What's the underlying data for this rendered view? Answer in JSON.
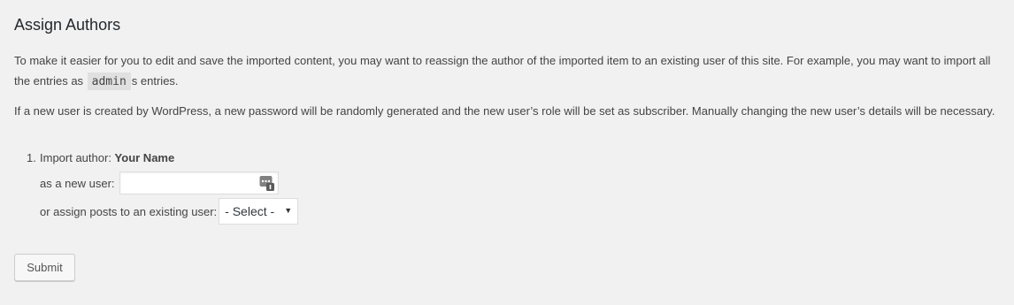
{
  "page": {
    "title": "Assign Authors",
    "intro_before_code": "To make it easier for you to edit and save the imported content, you may want to reassign the author of the imported item to an existing user of this site. For example, you may want to import all the entries as ",
    "intro_code": "admin",
    "intro_after_code": "s entries.",
    "notice": "If a new user is created by WordPress, a new password will be randomly generated and the new user’s role will be set as subscriber. Manually changing the new user’s details will be necessary."
  },
  "authors": [
    {
      "number": "1.",
      "prefix": "Import author: ",
      "name": "Your Name",
      "new_user_label": "as a new user:",
      "new_user_value": "",
      "existing_user_label": "or assign posts to an existing user:",
      "existing_user_selected": "- Select -"
    }
  ],
  "icons": {
    "password_manager": "key-badge-icon",
    "select_arrow": "triangle-down-icon"
  },
  "submit_label": "Submit"
}
